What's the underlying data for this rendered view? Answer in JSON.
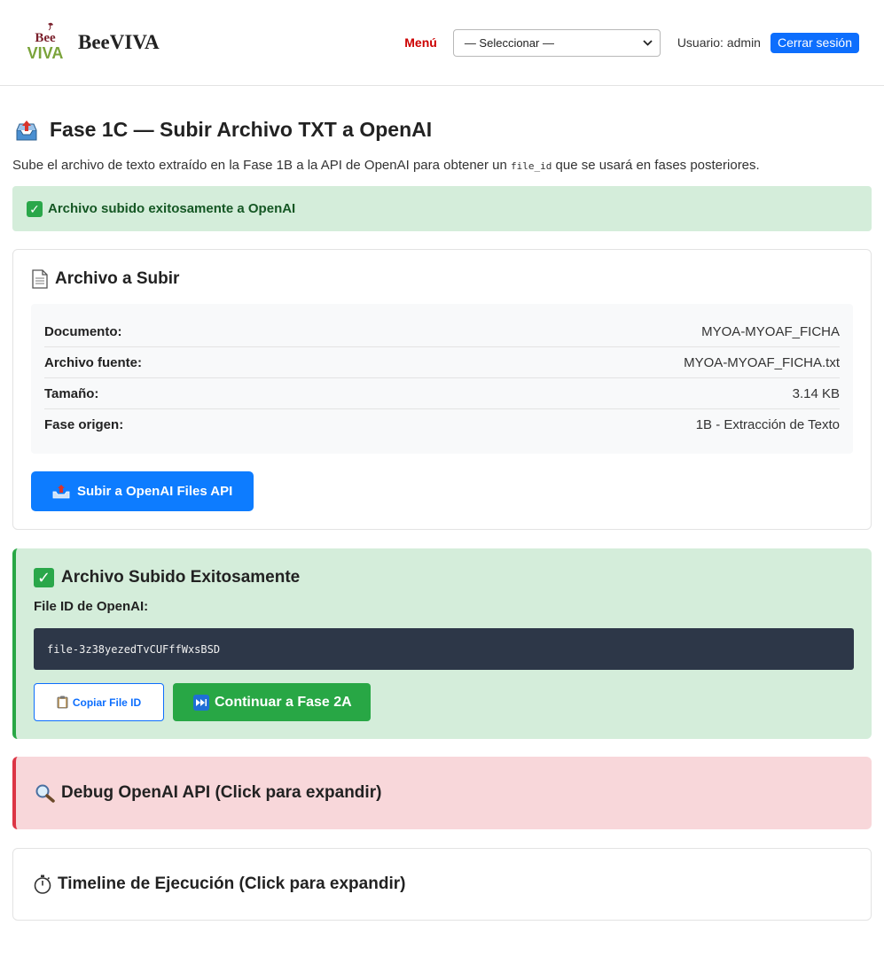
{
  "header": {
    "logo_text_top": "Bee",
    "logo_text_bottom": "VIVA",
    "brand": "BeeVIVA",
    "menu_label": "Menú",
    "menu_select_value": "— Seleccionar —",
    "user_text": "Usuario: admin",
    "logout_label": "Cerrar sesión"
  },
  "page": {
    "title": "Fase 1C — Subir Archivo TXT a OpenAI",
    "desc_before": "Sube el archivo de texto extraído en la Fase 1B a la API de OpenAI para obtener un ",
    "desc_code": "file_id",
    "desc_after": " que se usará en fases posteriores."
  },
  "alert": {
    "text": "Archivo subido exitosamente a OpenAI"
  },
  "upload_card": {
    "title": "Archivo a Subir",
    "rows": [
      {
        "key": "Documento:",
        "value": "MYOA-MYOAF_FICHA"
      },
      {
        "key": "Archivo fuente:",
        "value": "MYOA-MYOAF_FICHA.txt"
      },
      {
        "key": "Tamaño:",
        "value": "3.14 KB"
      },
      {
        "key": "Fase origen:",
        "value": "1B - Extracción de Texto"
      }
    ],
    "button_label": "Subir a OpenAI Files API"
  },
  "success_card": {
    "title": "Archivo Subido Exitosamente",
    "file_id_label": "File ID de OpenAI:",
    "file_id": "file-3z38yezedTvCUFffWxsBSD",
    "copy_label": "Copiar File ID",
    "continue_label": "Continuar a Fase 2A"
  },
  "debug_card": {
    "title": "Debug OpenAI API (Click para expandir)"
  },
  "timeline_card": {
    "title": "Timeline de Ejecución (Click para expandir)"
  },
  "colors": {
    "primary": "#0d7cff",
    "success": "#28a745",
    "success_bg": "#d4edda",
    "danger": "#dc3545",
    "danger_bg": "#f8d7da",
    "menu_red": "#cc0000"
  }
}
